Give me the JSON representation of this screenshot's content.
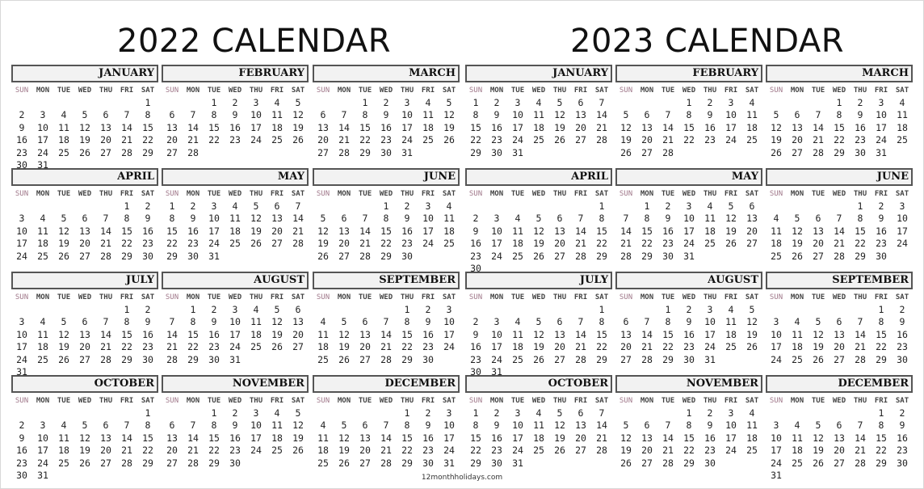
{
  "weekday_labels": [
    "SUN",
    "MON",
    "TUE",
    "WED",
    "THU",
    "FRI",
    "SAT"
  ],
  "years": [
    {
      "title": "2022 CALENDAR",
      "months": [
        {
          "name": "JANUARY",
          "start": 6,
          "days": 31
        },
        {
          "name": "FEBRUARY",
          "start": 2,
          "days": 28
        },
        {
          "name": "MARCH",
          "start": 2,
          "days": 31
        },
        {
          "name": "APRIL",
          "start": 5,
          "days": 30
        },
        {
          "name": "MAY",
          "start": 0,
          "days": 31
        },
        {
          "name": "JUNE",
          "start": 3,
          "days": 30
        },
        {
          "name": "JULY",
          "start": 5,
          "days": 31
        },
        {
          "name": "AUGUST",
          "start": 1,
          "days": 31
        },
        {
          "name": "SEPTEMBER",
          "start": 4,
          "days": 30
        },
        {
          "name": "OCTOBER",
          "start": 6,
          "days": 31
        },
        {
          "name": "NOVEMBER",
          "start": 2,
          "days": 30
        },
        {
          "name": "DECEMBER",
          "start": 4,
          "days": 31
        }
      ]
    },
    {
      "title": "2023 CALENDAR",
      "months": [
        {
          "name": "JANUARY",
          "start": 0,
          "days": 31
        },
        {
          "name": "FEBRUARY",
          "start": 3,
          "days": 28
        },
        {
          "name": "MARCH",
          "start": 3,
          "days": 31
        },
        {
          "name": "APRIL",
          "start": 6,
          "days": 30
        },
        {
          "name": "MAY",
          "start": 1,
          "days": 31
        },
        {
          "name": "JUNE",
          "start": 4,
          "days": 30
        },
        {
          "name": "JULY",
          "start": 6,
          "days": 31
        },
        {
          "name": "AUGUST",
          "start": 2,
          "days": 31
        },
        {
          "name": "SEPTEMBER",
          "start": 5,
          "days": 30
        },
        {
          "name": "OCTOBER",
          "start": 0,
          "days": 31
        },
        {
          "name": "NOVEMBER",
          "start": 3,
          "days": 30
        },
        {
          "name": "DECEMBER",
          "start": 5,
          "days": 31
        }
      ]
    }
  ],
  "footer": "12monthholidays.com"
}
